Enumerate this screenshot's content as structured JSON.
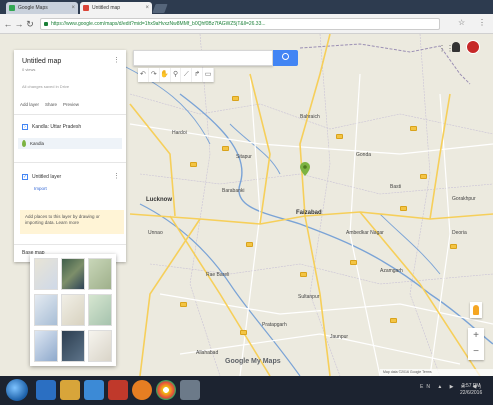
{
  "browser": {
    "tabs": [
      {
        "title": "Google Maps"
      },
      {
        "title": "Untitled map"
      }
    ],
    "url": "https://www.google.com/maps/d/edit?mid=1hx9aHvxzNw8MMf_b0Qhf0Bz7fAGWZ5jT&ll=26.33..."
  },
  "map_panel": {
    "title": "Untitled map",
    "views": "0 views",
    "saved": "All changes saved in Drive",
    "actions": [
      "Add layer",
      "Share",
      "Preview"
    ],
    "layer1": {
      "name": "Kandla: Uttar Pradesh",
      "item": "Kandla"
    },
    "layer2": {
      "name": "Untitled layer",
      "import": "Import"
    },
    "tip": "Add places to this layer by drawing or importing data. Learn more",
    "basemap": "Base map"
  },
  "search": {
    "placeholder": ""
  },
  "map": {
    "cities": [
      "Lucknow",
      "Faizabad"
    ],
    "towns": [
      "Hardoi",
      "Sitapur",
      "Barabanki",
      "Gonda",
      "Bahraich",
      "Unnao",
      "Rae Bareli",
      "Sultanpur",
      "Pratapgarh",
      "Allahabad",
      "Ambedkar Nagar",
      "Basti",
      "Azamgarh",
      "Jaunpur",
      "Gorakhpur",
      "Deoria"
    ],
    "logo": "Google My Maps",
    "attribution": "Map data ©2016 Google  Terms"
  },
  "taskbar": {
    "tray": "EN ▲ ▶ ✉ ◀)",
    "time": "2:57 PM",
    "date": "22/6/2016"
  },
  "colors": {
    "accent": "#4285f4",
    "river": "#7aa3d6",
    "road_major": "#f6cf5a",
    "road_minor": "#ffffff",
    "marker": "#7cb342"
  }
}
